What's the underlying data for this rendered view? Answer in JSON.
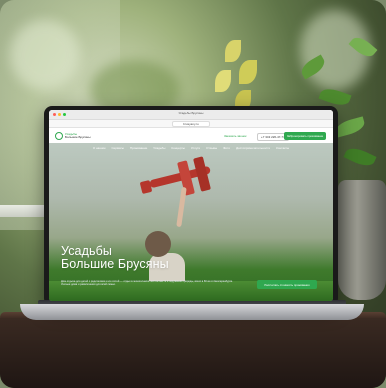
{
  "browser": {
    "tab_title": "Усадьбы Брусяны",
    "url": "brusyany.ru"
  },
  "site": {
    "logo": {
      "top": "Усадьбы",
      "bottom": "Большие Брусяны"
    },
    "callback": "Заказать звонок",
    "phone": "+7 343 226-47-77",
    "book_button": "Забронировать проживание",
    "nav": [
      "О нашем",
      "Сервисы",
      "Проживание",
      "Усадьбы",
      "Концерты",
      "Услуги",
      "Отзывы",
      "Фото",
      "Достопримечательности",
      "Контакты"
    ],
    "hero": {
      "title_line1": "Усадьбы",
      "title_line2": "Большие Брусяны",
      "description": "Дом отдыха для детей с родителями и их гостей — отдых в экологически чистом месте в окружении природы, всего в 60 км от Екатеринбурга. Уютные дома и развлечения для всей семьи.",
      "cta": "Рассчитать стоимость проживания"
    }
  },
  "colors": {
    "brand_green": "#2fa84f",
    "plane_red": "#b5362c"
  }
}
